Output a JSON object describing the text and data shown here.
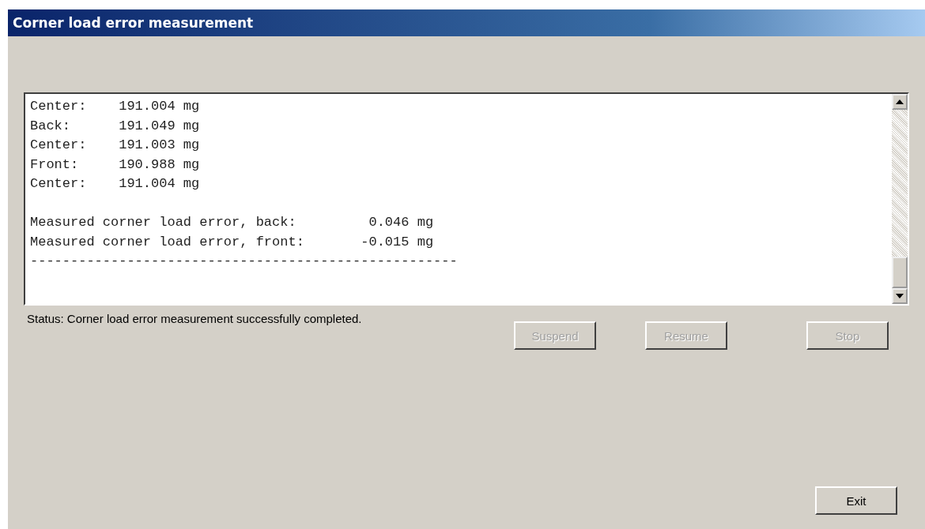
{
  "window": {
    "title": "Corner load error measurement"
  },
  "log": {
    "readings": [
      "Center:    191.004 mg",
      "Back:      191.049 mg",
      "Center:    191.003 mg",
      "Front:     190.988 mg",
      "Center:    191.004 mg"
    ],
    "results": [
      "Measured corner load error, back:         0.046 mg",
      "Measured corner load error, front:       -0.015 mg"
    ],
    "separator": "-----------------------------------------------------"
  },
  "status": "Status: Corner load error measurement successfully completed.",
  "buttons": [
    {
      "label": "Suspend",
      "disabled": true
    },
    {
      "label": "Resume",
      "disabled": true
    },
    {
      "label": "Stop",
      "disabled": true
    }
  ],
  "exit_button": {
    "label": "Exit",
    "disabled": false
  }
}
